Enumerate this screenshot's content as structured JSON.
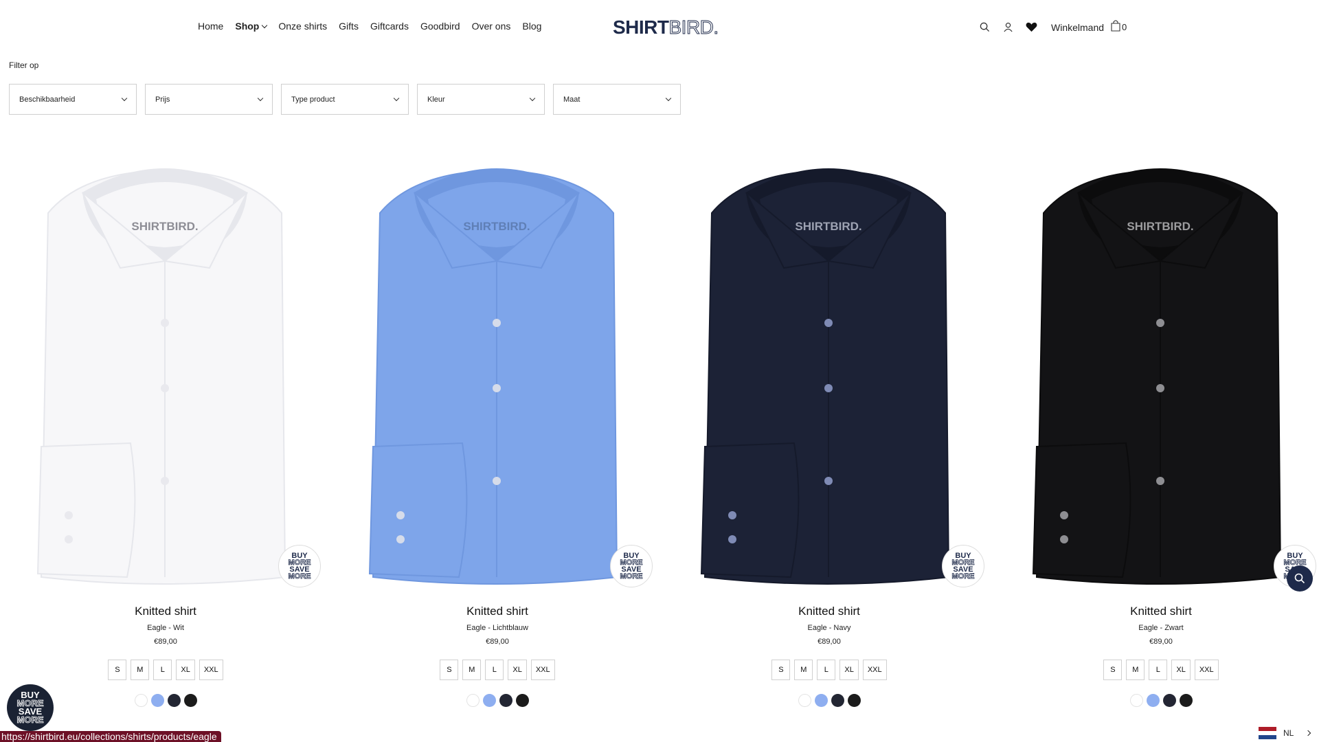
{
  "nav": {
    "items": [
      {
        "label": "Home"
      },
      {
        "label": "Shop",
        "has_dropdown": true
      },
      {
        "label": "Onze shirts"
      },
      {
        "label": "Gifts"
      },
      {
        "label": "Giftcards"
      },
      {
        "label": "Goodbird"
      },
      {
        "label": "Over ons"
      },
      {
        "label": "Blog"
      }
    ]
  },
  "logo": {
    "part1": "SHIRT",
    "part2": "BIRD."
  },
  "header": {
    "icons": [
      "search-icon",
      "account-icon",
      "heart-icon"
    ],
    "cart_label": "Winkelmand",
    "cart_count": "0"
  },
  "filters": {
    "title": "Filter op",
    "items": [
      {
        "label": "Beschikbaarheid"
      },
      {
        "label": "Prijs"
      },
      {
        "label": "Type product"
      },
      {
        "label": "Kleur"
      },
      {
        "label": "Maat"
      }
    ]
  },
  "products": [
    {
      "title": "Knitted shirt",
      "subtitle": "Eagle - Wit",
      "price": "€89,00",
      "color": "#f7f7f9",
      "accent": "#e6e7ec",
      "logo_color": "#8d8d95",
      "button_color": "#e9e9ee"
    },
    {
      "title": "Knitted shirt",
      "subtitle": "Eagle - Lichtblauw",
      "price": "€89,00",
      "color": "#7ea5ea",
      "accent": "#6f97df",
      "logo_color": "#5f7fb6",
      "button_color": "#d6dcea"
    },
    {
      "title": "Knitted shirt",
      "subtitle": "Eagle - Navy",
      "price": "€89,00",
      "color": "#1c2236",
      "accent": "#151a2b",
      "logo_color": "#9ea3b3",
      "button_color": "#7f8bb5"
    },
    {
      "title": "Knitted shirt",
      "subtitle": "Eagle - Zwart",
      "price": "€89,00",
      "color": "#131315",
      "accent": "#0c0c0d",
      "logo_color": "#9d9d9f",
      "button_color": "#8e8e92"
    }
  ],
  "sizes": [
    "S",
    "M",
    "L",
    "XL",
    "XXL"
  ],
  "swatches": [
    {
      "name": "wit",
      "color": "#ffffff"
    },
    {
      "name": "lichtblauw",
      "color": "#8eaef0"
    },
    {
      "name": "navy",
      "color": "#232633"
    },
    {
      "name": "zwart",
      "color": "#1b1b1b"
    }
  ],
  "promo_badge": {
    "lines": [
      "BUY",
      "MORE",
      "SAVE",
      "MORE"
    ]
  },
  "status_url": "https://shirtbird.eu/collections/shirts/products/eagle",
  "language": {
    "code": "NL"
  }
}
